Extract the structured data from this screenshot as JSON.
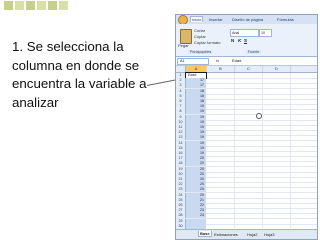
{
  "caption": "1. Se selecciona la columna en donde se encuentra la variable a analizar",
  "excel": {
    "ribbon_tabs": [
      "Inicio",
      "Insertar",
      "Diseño de página",
      "Fórmulas"
    ],
    "clipboard": {
      "paste_label": "Pegar",
      "cut_label": "Cortar",
      "copy_label": "Copiar",
      "format_painter_label": "Copiar formato",
      "group_label": "Portapapeles"
    },
    "font": {
      "name": "Arial",
      "size": "10",
      "bold": "N",
      "italic": "K",
      "underline": "S",
      "group_label": "Fuente"
    },
    "name_box": "A1",
    "fx_label": "fx",
    "formula_value": "Edad",
    "columns": [
      "A",
      "B",
      "C",
      "D"
    ],
    "rows": [
      {
        "n": "1",
        "v": "Edad"
      },
      {
        "n": "2",
        "v": "17"
      },
      {
        "n": "3",
        "v": "17"
      },
      {
        "n": "4",
        "v": "18"
      },
      {
        "n": "5",
        "v": "18"
      },
      {
        "n": "6",
        "v": "18"
      },
      {
        "n": "7",
        "v": "19"
      },
      {
        "n": "8",
        "v": "19"
      },
      {
        "n": "9",
        "v": "19"
      },
      {
        "n": "10",
        "v": "19"
      },
      {
        "n": "11",
        "v": "19"
      },
      {
        "n": "12",
        "v": "19"
      },
      {
        "n": "13",
        "v": "19"
      },
      {
        "n": "14",
        "v": "19"
      },
      {
        "n": "15",
        "v": "19"
      },
      {
        "n": "16",
        "v": "19"
      },
      {
        "n": "17",
        "v": "20"
      },
      {
        "n": "18",
        "v": "20"
      },
      {
        "n": "19",
        "v": "20"
      },
      {
        "n": "20",
        "v": "20"
      },
      {
        "n": "21",
        "v": "20"
      },
      {
        "n": "22",
        "v": "20"
      },
      {
        "n": "23",
        "v": "20"
      },
      {
        "n": "24",
        "v": "20"
      },
      {
        "n": "25",
        "v": "21"
      },
      {
        "n": "26",
        "v": "22"
      },
      {
        "n": "27",
        "v": "23"
      },
      {
        "n": "28",
        "v": "24"
      },
      {
        "n": "29",
        "v": ""
      },
      {
        "n": "30",
        "v": ""
      }
    ],
    "sheet_tabs": [
      "Base",
      "Estimaciones",
      "Hoja2",
      "Hoja3"
    ],
    "colors": {
      "selected_column": "#c9d9f0",
      "ribbon": "#eaf1fb",
      "accent": "#f7c95e"
    }
  }
}
